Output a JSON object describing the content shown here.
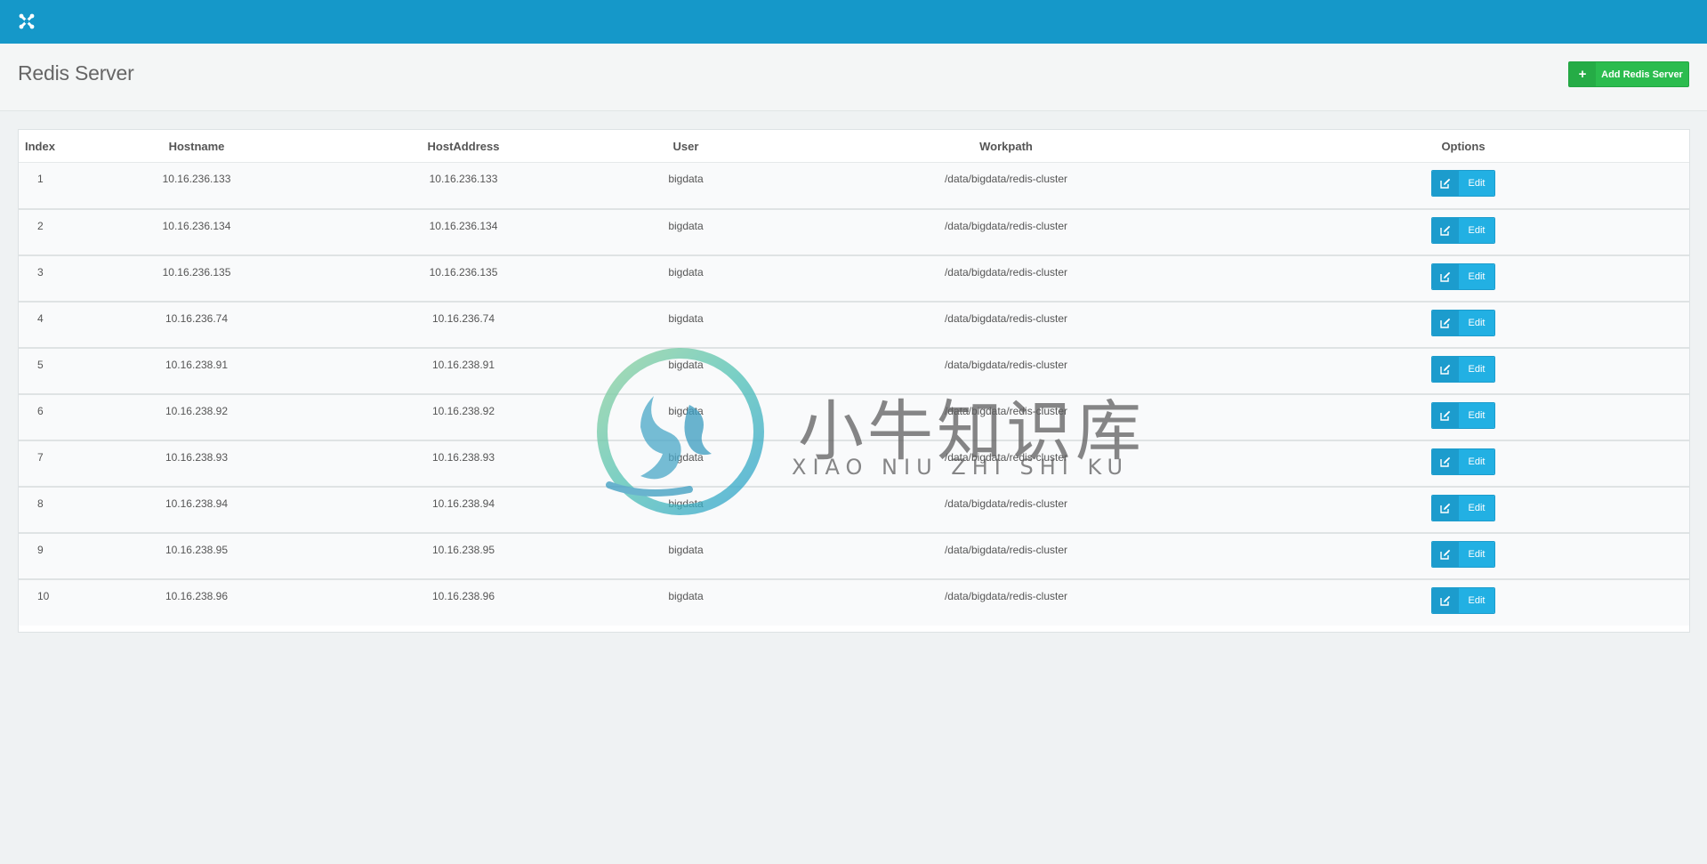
{
  "colors": {
    "topbar": "#1598c9",
    "add_button": "#2bbc4e",
    "edit_button": "#22b0e3"
  },
  "header": {
    "title": "Redis Server",
    "add_button_label": "Add Redis Server",
    "add_button_icon": "plus-icon"
  },
  "table": {
    "columns": [
      "Index",
      "Hostname",
      "HostAddress",
      "User",
      "Workpath",
      "Options"
    ],
    "edit_label": "Edit",
    "edit_icon": "edit-icon",
    "rows": [
      {
        "index": "1",
        "hostname": "10.16.236.133",
        "hostaddress": "10.16.236.133",
        "user": "bigdata",
        "workpath": "/data/bigdata/redis-cluster"
      },
      {
        "index": "2",
        "hostname": "10.16.236.134",
        "hostaddress": "10.16.236.134",
        "user": "bigdata",
        "workpath": "/data/bigdata/redis-cluster"
      },
      {
        "index": "3",
        "hostname": "10.16.236.135",
        "hostaddress": "10.16.236.135",
        "user": "bigdata",
        "workpath": "/data/bigdata/redis-cluster"
      },
      {
        "index": "4",
        "hostname": "10.16.236.74",
        "hostaddress": "10.16.236.74",
        "user": "bigdata",
        "workpath": "/data/bigdata/redis-cluster"
      },
      {
        "index": "5",
        "hostname": "10.16.238.91",
        "hostaddress": "10.16.238.91",
        "user": "bigdata",
        "workpath": "/data/bigdata/redis-cluster"
      },
      {
        "index": "6",
        "hostname": "10.16.238.92",
        "hostaddress": "10.16.238.92",
        "user": "bigdata",
        "workpath": "/data/bigdata/redis-cluster"
      },
      {
        "index": "7",
        "hostname": "10.16.238.93",
        "hostaddress": "10.16.238.93",
        "user": "bigdata",
        "workpath": "/data/bigdata/redis-cluster"
      },
      {
        "index": "8",
        "hostname": "10.16.238.94",
        "hostaddress": "10.16.238.94",
        "user": "bigdata",
        "workpath": "/data/bigdata/redis-cluster"
      },
      {
        "index": "9",
        "hostname": "10.16.238.95",
        "hostaddress": "10.16.238.95",
        "user": "bigdata",
        "workpath": "/data/bigdata/redis-cluster"
      },
      {
        "index": "10",
        "hostname": "10.16.238.96",
        "hostaddress": "10.16.238.96",
        "user": "bigdata",
        "workpath": "/data/bigdata/redis-cluster"
      }
    ]
  },
  "watermark": {
    "text_cn": "小牛知识库",
    "text_en": "XIAO NIU ZHI SHI KU"
  }
}
